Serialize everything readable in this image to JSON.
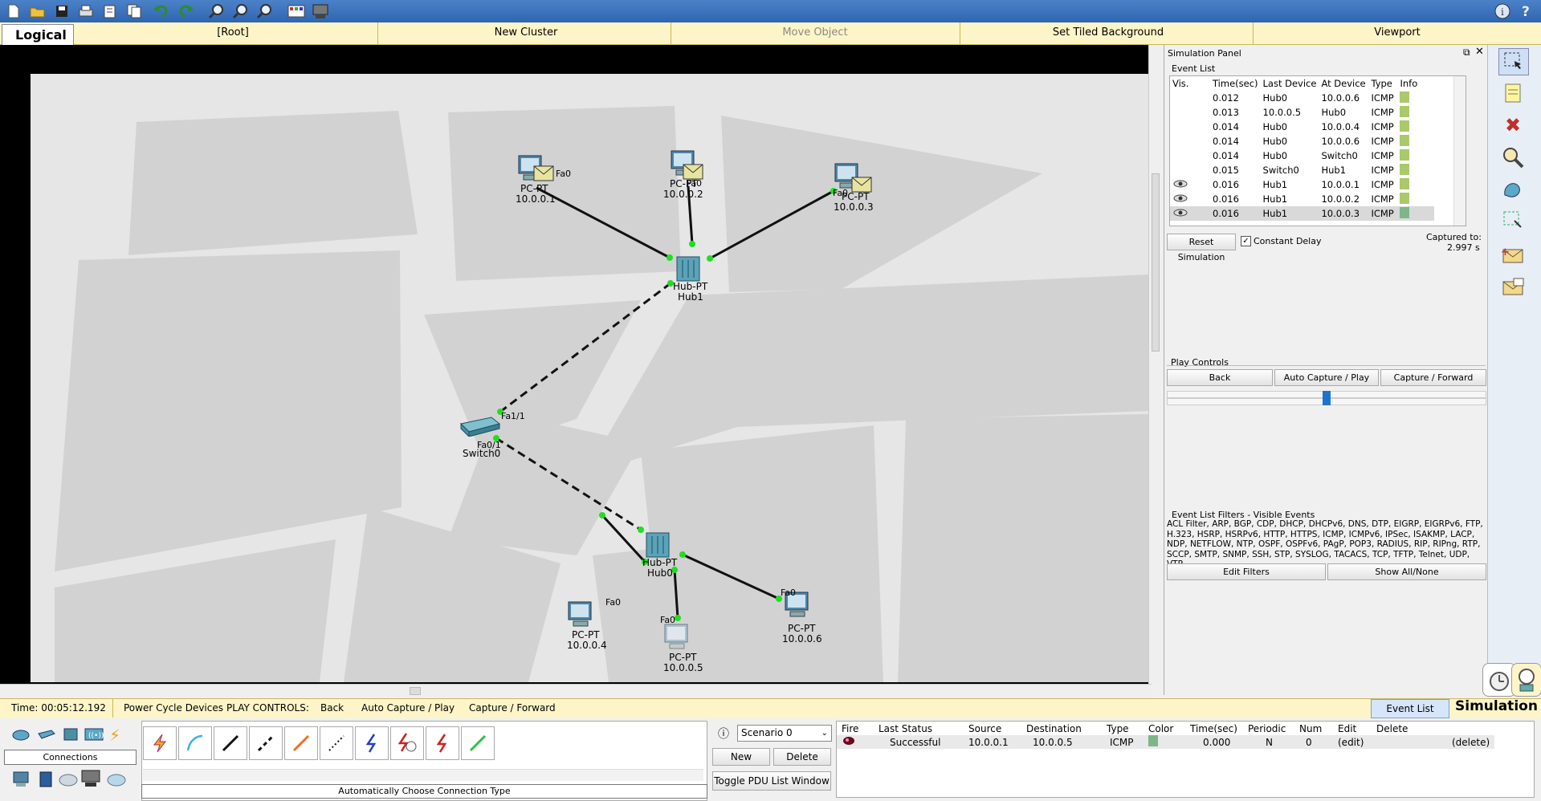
{
  "toolbar": {
    "icons": [
      "new-file-icon",
      "open-folder-icon",
      "save-icon",
      "print-icon",
      "activity-wizard-icon",
      "copy-icon",
      "undo-icon",
      "redo-icon",
      "zoom-in-icon",
      "zoom-reset-icon",
      "zoom-out-icon",
      "palette-icon",
      "custom-device-icon"
    ],
    "right_icons": [
      "info-icon",
      "help-icon"
    ]
  },
  "topbar": {
    "logical": "Logical",
    "root": "[Root]",
    "new_cluster": "New Cluster",
    "move_object": "Move Object",
    "set_tiled_background": "Set Tiled Background",
    "viewport": "Viewport"
  },
  "topology": {
    "devices": [
      {
        "id": "pc1",
        "model": "PC-PT",
        "name": "10.0.0.1",
        "port": "Fa0"
      },
      {
        "id": "pc2",
        "model": "PC-PT",
        "name": "10.0.0.2",
        "port": "Fa0"
      },
      {
        "id": "pc3",
        "model": "PC-PT",
        "name": "10.0.0.3",
        "port": "Fa0"
      },
      {
        "id": "hub1",
        "model": "Hub-PT",
        "name": "Hub1"
      },
      {
        "id": "switch0",
        "model": "Switch-PT",
        "name": "Switch0",
        "port1": "Fa1/1",
        "port2": "Fa0/1"
      },
      {
        "id": "hub0",
        "model": "Hub-PT",
        "name": "Hub0"
      },
      {
        "id": "pc4",
        "model": "PC-PT",
        "name": "10.0.0.4",
        "port": "Fa0"
      },
      {
        "id": "pc5",
        "model": "PC-PT",
        "name": "10.0.0.5",
        "port": "Fa0"
      },
      {
        "id": "pc6",
        "model": "PC-PT",
        "name": "10.0.0.6",
        "port": "Fa0"
      }
    ]
  },
  "sim_panel": {
    "title": "Simulation Panel",
    "event_list_label": "Event List",
    "columns": [
      "Vis.",
      "Time(sec)",
      "Last Device",
      "At Device",
      "Type",
      "Info"
    ],
    "events": [
      {
        "vis": "",
        "time": "0.012",
        "last": "Hub0",
        "at": "10.0.0.6",
        "type": "ICMP",
        "color": "#a9c96a"
      },
      {
        "vis": "",
        "time": "0.013",
        "last": "10.0.0.5",
        "at": "Hub0",
        "type": "ICMP",
        "color": "#a9c96a"
      },
      {
        "vis": "",
        "time": "0.014",
        "last": "Hub0",
        "at": "10.0.0.4",
        "type": "ICMP",
        "color": "#a9c96a"
      },
      {
        "vis": "",
        "time": "0.014",
        "last": "Hub0",
        "at": "10.0.0.6",
        "type": "ICMP",
        "color": "#a9c96a"
      },
      {
        "vis": "",
        "time": "0.014",
        "last": "Hub0",
        "at": "Switch0",
        "type": "ICMP",
        "color": "#a9c96a"
      },
      {
        "vis": "",
        "time": "0.015",
        "last": "Switch0",
        "at": "Hub1",
        "type": "ICMP",
        "color": "#a9c96a"
      },
      {
        "vis": "eye",
        "time": "0.016",
        "last": "Hub1",
        "at": "10.0.0.1",
        "type": "ICMP",
        "color": "#a9c96a"
      },
      {
        "vis": "eye",
        "time": "0.016",
        "last": "Hub1",
        "at": "10.0.0.2",
        "type": "ICMP",
        "color": "#a9c96a"
      },
      {
        "vis": "eye",
        "time": "0.016",
        "last": "Hub1",
        "at": "10.0.0.3",
        "type": "ICMP",
        "color": "#7fb58a"
      }
    ],
    "reset_simulation": "Reset Simulation",
    "constant_delay": "Constant Delay",
    "constant_delay_checked": true,
    "captured_to_label": "Captured to:",
    "captured_to_value": "2.997 s",
    "play_controls_label": "Play Controls",
    "back": "Back",
    "auto_capture_play": "Auto Capture / Play",
    "capture_forward": "Capture / Forward",
    "slider_position": 0.5,
    "filters_label": "Event List Filters - Visible Events",
    "filters_text": "ACL Filter, ARP, BGP, CDP, DHCP, DHCPv6, DNS, DTP, EIGRP, EIGRPv6, FTP, H.323, HSRP, HSRPv6, HTTP, HTTPS, ICMP, ICMPv6, IPSec, ISAKMP, LACP, NDP, NETFLOW, NTP, OSPF, OSPFv6, PAgP, POP3, RADIUS, RIP, RIPng, RTP, SCCP, SMTP, SNMP, SSH, STP, SYSLOG, TACACS, TCP, TFTP, Telnet, UDP, VTP",
    "edit_filters": "Edit Filters",
    "show_all_none": "Show All/None"
  },
  "right_tools": [
    "select-icon",
    "note-icon",
    "delete-icon",
    "inspect-icon",
    "draw-shape-icon",
    "resize-icon",
    "add-simple-pdu-icon",
    "add-complex-pdu-icon"
  ],
  "status_bar": {
    "time": "Time: 00:05:12.192",
    "power_cycle": "Power Cycle Devices",
    "play_controls": "PLAY CONTROLS:",
    "back": "Back",
    "auto_capture_play": "Auto Capture / Play",
    "capture_forward": "Capture / Forward",
    "event_list": "Event List",
    "simulation": "Simulation"
  },
  "device_panel": {
    "category_label": "Connections",
    "connection_hint": "Automatically Choose Connection Type",
    "connection_types": [
      "automatic-connection-icon",
      "console-cable-icon",
      "copper-straight-through-icon",
      "copper-cross-over-icon",
      "fiber-icon",
      "phone-cable-icon",
      "coaxial-icon",
      "serial-dce-icon",
      "serial-dte-icon",
      "octal-cable-icon"
    ]
  },
  "scenario": {
    "selected": "Scenario 0",
    "new": "New",
    "delete": "Delete",
    "toggle": "Toggle PDU List Window"
  },
  "pdu_list": {
    "columns": [
      "Fire",
      "Last Status",
      "Source",
      "Destination",
      "Type",
      "Color",
      "Time(sec)",
      "Periodic",
      "Num",
      "Edit",
      "Delete"
    ],
    "rows": [
      {
        "fire": "",
        "status": "Successful",
        "source": "10.0.0.1",
        "destination": "10.0.0.5",
        "type": "ICMP",
        "color": "#7fb58a",
        "time": "0.000",
        "periodic": "N",
        "num": "0",
        "edit": "(edit)",
        "delete": "(delete)"
      }
    ]
  }
}
